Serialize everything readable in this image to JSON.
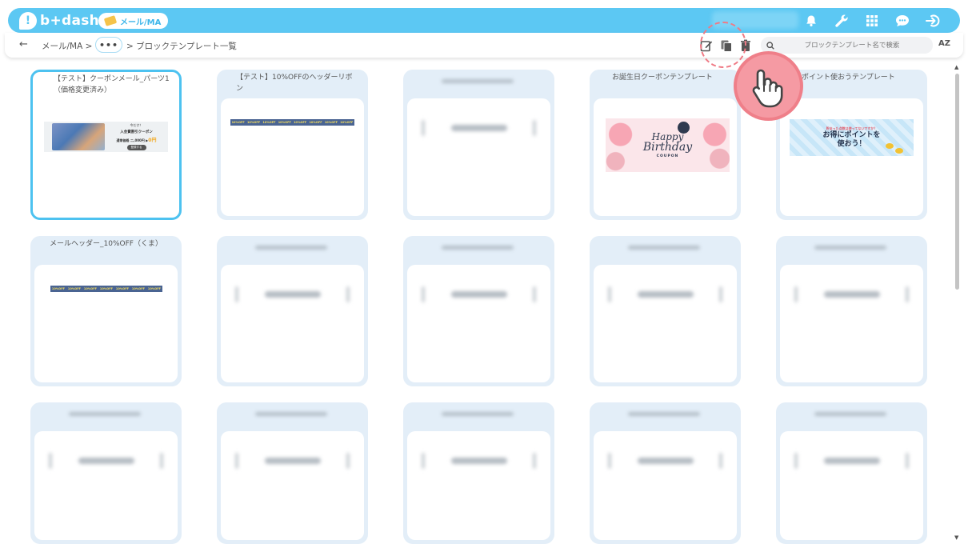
{
  "app": {
    "logo_text": "b+dash",
    "module_label": "メール/MA"
  },
  "breadcrumb": {
    "back": "←",
    "root": "メール/MA >",
    "ellipsis": "•••",
    "current": "> ブロックテンプレート一覧"
  },
  "search": {
    "placeholder": "ブロックテンプレート名で検索"
  },
  "sort": {
    "label": "AZ"
  },
  "templates": [
    {
      "title": "【テスト】クーポンメール_パーツ1（価格変更済み）"
    },
    {
      "title": "【テスト】10%OFFのヘッダーリボン"
    },
    {
      "title": "お誕生日クーポンテンプレート"
    },
    {
      "title": "ポイント使おうテンプレート"
    },
    {
      "title": "メールヘッダー_10%OFF（くま）"
    }
  ],
  "thumbs": {
    "coupon": {
      "line1": "今だけ！",
      "line2": "入会費割引クーポン",
      "price_label": "通常価格 二,000円 ▶",
      "price_value": "0円",
      "button": "登録する"
    },
    "ribbon_text": "10%OFF",
    "birthday": {
      "happy": "Happy",
      "birthday": "Birthday",
      "coupon": "COUPON"
    },
    "point": {
      "small": "貯まった点数は使ってないですか？",
      "big1": "お得にポイントを",
      "big2": "使おう！"
    }
  },
  "colors": {
    "brand": "#5cc8f3",
    "selected_border": "#4dc2f0",
    "card_bg": "#e3eef8",
    "highlight": "#ef7a85"
  },
  "icons": [
    "bell-icon",
    "wrench-icon",
    "grid-icon",
    "chat-icon",
    "logout-icon",
    "edit-icon",
    "copy-icon",
    "trash-icon",
    "search-icon",
    "pointer-hand-icon"
  ]
}
